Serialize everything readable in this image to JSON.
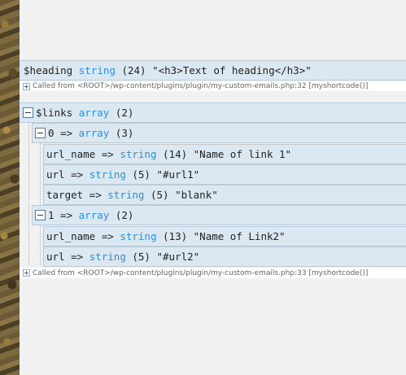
{
  "heading_var": {
    "name": "$heading",
    "type": "string",
    "length": "(24)",
    "value": "\"<h3>Text of heading</h3>\"",
    "called_from": "Called from <ROOT>/wp-content/plugins/plugin/my-custom-emails.php:32 [myshortcode()]"
  },
  "links_var": {
    "name": "$links",
    "type": "array",
    "count": "(2)",
    "called_from": "Called from <ROOT>/wp-content/plugins/plugin/my-custom-emails.php:33 [myshortcode()]",
    "items": [
      {
        "key": "0 =>",
        "type": "array",
        "count": "(3)",
        "fields": [
          {
            "key": "url_name =>",
            "type": "string",
            "length": "(14)",
            "value": "\"Name of link 1\""
          },
          {
            "key": "url =>",
            "type": "string",
            "length": "(5)",
            "value": "\"#url1\""
          },
          {
            "key": "target =>",
            "type": "string",
            "length": "(5)",
            "value": "\"blank\""
          }
        ]
      },
      {
        "key": "1 =>",
        "type": "array",
        "count": "(2)",
        "fields": [
          {
            "key": "url_name =>",
            "type": "string",
            "length": "(13)",
            "value": "\"Name of Link2\""
          },
          {
            "key": "url =>",
            "type": "string",
            "length": "(5)",
            "value": "\"#url2\""
          }
        ]
      }
    ]
  },
  "colors": {
    "row_bg": "#dce8f1",
    "row_border": "#b9cad9",
    "type_color": "#2d8fd6",
    "page_bg": "#f1f1f1"
  }
}
